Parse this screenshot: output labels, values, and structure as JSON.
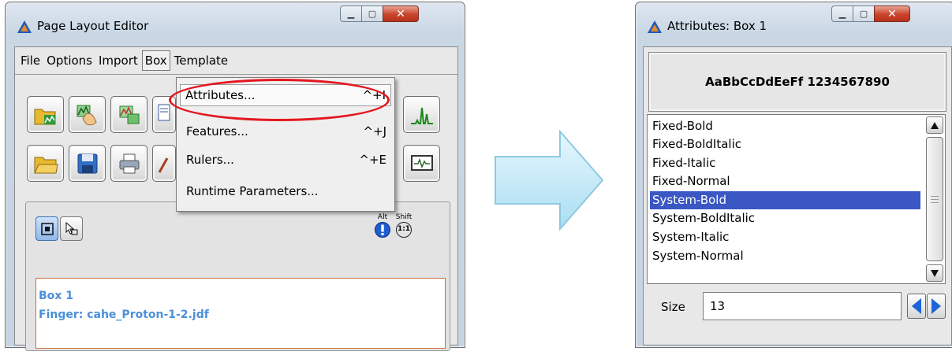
{
  "editor": {
    "title": "Page Layout Editor",
    "menu": [
      "File",
      "Options",
      "Import",
      "Box",
      "Template"
    ],
    "active_menu": "Box",
    "dropdown": [
      {
        "label": "Attributes...",
        "shortcut": "^+I"
      },
      {
        "label": "Features...",
        "shortcut": "^+J"
      },
      {
        "label": "Rulers...",
        "shortcut": "^+E"
      },
      {
        "label": "Runtime Parameters...",
        "shortcut": ""
      }
    ],
    "alt_label": "Alt",
    "shift_label": "Shift",
    "shift_glyph": "1:1",
    "box_name": "Box 1",
    "finger": "Finger: cahe_Proton-1-2.jdf"
  },
  "attributes": {
    "title": "Attributes: Box 1",
    "preview_text": "AaBbCcDdEeFf 1234567890",
    "fonts": [
      "Fixed-Bold",
      "Fixed-BoldItalic",
      "Fixed-Italic",
      "Fixed-Normal",
      "System-Bold",
      "System-BoldItalic",
      "System-Italic",
      "System-Normal"
    ],
    "selected_font": "System-Bold",
    "size_label": "Size",
    "size_value": "13"
  },
  "colors": {
    "selection": "#3a57c4",
    "highlight_ellipse": "#e3181f",
    "info_text": "#4a90d9",
    "info_border": "#c8703a",
    "arrow_fill": "#bfe8f6"
  }
}
